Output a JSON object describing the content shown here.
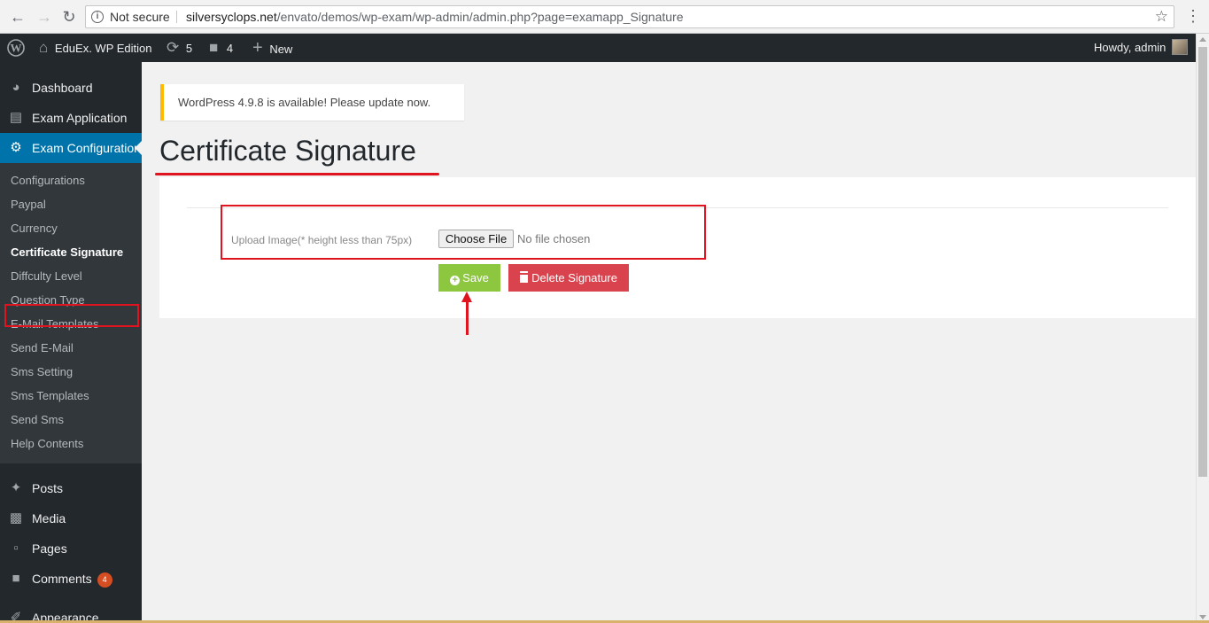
{
  "browser": {
    "security_label": "Not secure",
    "url_host": "silversyclops.net",
    "url_path": "/envato/demos/wp-exam/wp-admin/admin.php?page=examapp_Signature"
  },
  "adminbar": {
    "site_name": "EduEx. WP Edition",
    "updates_count": "5",
    "comments_count": "4",
    "new_label": "New",
    "howdy": "Howdy, admin"
  },
  "sidebar": {
    "top_items": [
      {
        "label": "Dashboard",
        "icon": "dashboard-icon"
      },
      {
        "label": "Exam Application",
        "icon": "id-card-icon"
      },
      {
        "label": "Exam Configuration",
        "icon": "gear-icon"
      }
    ],
    "submenu": [
      "Configurations",
      "Paypal",
      "Currency",
      "Certificate Signature",
      "Diffculty Level",
      "Question Type",
      "E-Mail Templates",
      "Send E-Mail",
      "Sms Setting",
      "Sms Templates",
      "Send Sms",
      "Help Contents"
    ],
    "bottom_items": [
      {
        "label": "Posts",
        "icon": "pin-icon"
      },
      {
        "label": "Media",
        "icon": "media-icon"
      },
      {
        "label": "Pages",
        "icon": "pages-icon"
      },
      {
        "label": "Comments",
        "icon": "comment-icon",
        "badge": "4"
      },
      {
        "label": "Appearance",
        "icon": "brush-icon"
      }
    ]
  },
  "notice": {
    "text": "WordPress 4.9.8 is available! Please update now."
  },
  "page": {
    "title": "Certificate Signature",
    "upload_label": "Upload Image(* height less than 75px)",
    "choose_file_label": "Choose File",
    "no_file_text": "No file chosen",
    "save_label": "Save",
    "delete_label": "Delete Signature"
  },
  "colors": {
    "accent_blue": "#0073aa",
    "save_green": "#8dc63f",
    "delete_red": "#d9434e",
    "annotation_red": "#e0141e",
    "notice_yellow": "#ffb900"
  }
}
